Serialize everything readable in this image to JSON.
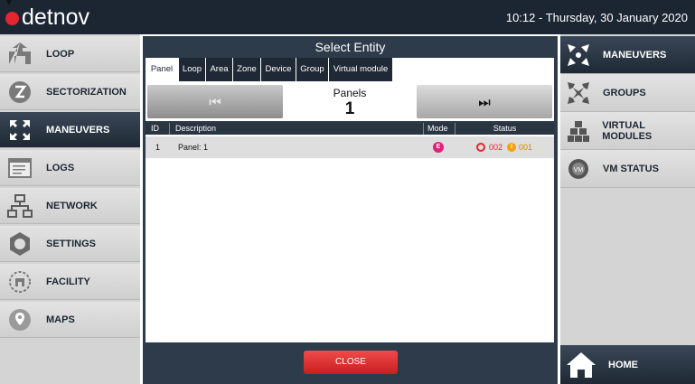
{
  "header": {
    "brand": "detnov",
    "datetime": "10:12 - Thursday, 30 January 2020",
    "brand_dot_color": "#e3262f"
  },
  "left_nav": {
    "items": [
      {
        "label": "LOOP",
        "icon": "loop-icon"
      },
      {
        "label": "SECTORIZATION",
        "icon": "sectorization-icon"
      },
      {
        "label": "MANEUVERS",
        "icon": "maneuvers-icon",
        "active": true
      },
      {
        "label": "LOGS",
        "icon": "logs-icon"
      },
      {
        "label": "NETWORK",
        "icon": "network-icon"
      },
      {
        "label": "SETTINGS",
        "icon": "settings-icon"
      },
      {
        "label": "FACILITY",
        "icon": "facility-icon"
      },
      {
        "label": "MAPS",
        "icon": "maps-icon"
      }
    ]
  },
  "dialog": {
    "title": "Select Entity",
    "tabs": [
      "Panel",
      "Loop",
      "Area",
      "Zone",
      "Device",
      "Group",
      "Virtual module"
    ],
    "active_tab": "Panel",
    "pager": {
      "label": "Panels",
      "value": "1",
      "prev_glyph": "⏮",
      "next_glyph": "⏭"
    },
    "table": {
      "headers": {
        "id": "ID",
        "description": "Description",
        "mode": "Mode",
        "status": "Status"
      },
      "rows": [
        {
          "id": "1",
          "description": "Panel: 1",
          "mode": "E",
          "status_alarm": "002",
          "status_warning": "001"
        }
      ]
    },
    "close_label": "CLOSE"
  },
  "right_nav": {
    "items": [
      {
        "label": "MANEUVERS",
        "icon": "maneuvers-icon",
        "active": true
      },
      {
        "label": "GROUPS",
        "icon": "groups-icon"
      },
      {
        "label": "VIRTUAL MODULES",
        "icon": "virtual-modules-icon"
      },
      {
        "label": "VM STATUS",
        "icon": "vm-status-icon"
      }
    ],
    "home_label": "HOME"
  },
  "colors": {
    "dark": "#1c2633",
    "panel": "#2e3b4a",
    "accent_red": "#e3262f",
    "mode_badge": "#e0207a",
    "warning": "#f2a20c"
  }
}
